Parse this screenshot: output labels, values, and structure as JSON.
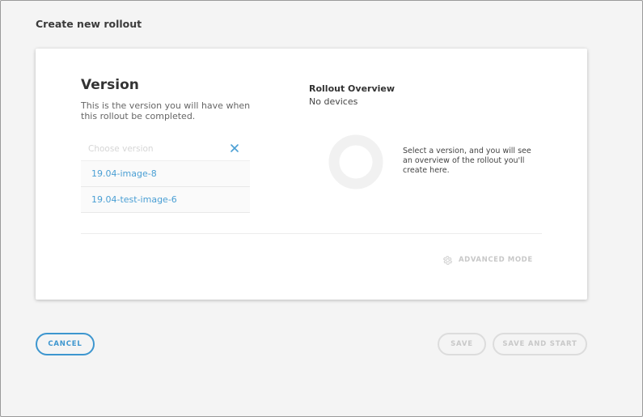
{
  "page": {
    "title": "Create new rollout"
  },
  "version": {
    "title": "Version",
    "description": "This is the version you will have when this rollout be completed.",
    "select": {
      "placeholder": "Choose version",
      "value": "",
      "options": [
        "19.04-image-8",
        "19.04-test-image-6"
      ]
    }
  },
  "overview": {
    "title": "Rollout Overview",
    "subtitle": "No devices",
    "hint": "Select a version, and you will see an overview of the rollout you'll create here.",
    "chart_data": {
      "type": "pie",
      "values": [],
      "title": ""
    }
  },
  "advanced_mode": {
    "label": "ADVANCED MODE",
    "icon": "gear-icon"
  },
  "actions": {
    "cancel_label": "CANCEL",
    "save_label": "SAVE",
    "save_start_label": "SAVE AND START"
  },
  "colors": {
    "accent": "#3d96cf",
    "link": "#4a9fd4",
    "disabled": "#c8c8c8",
    "background": "#f4f4f4"
  }
}
